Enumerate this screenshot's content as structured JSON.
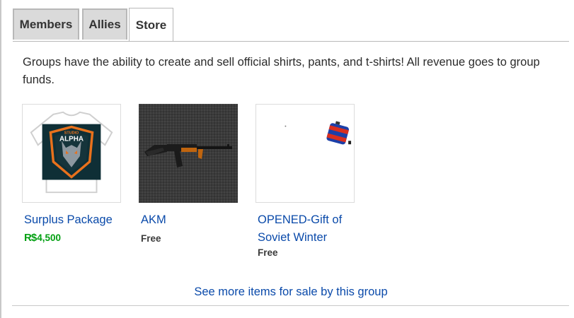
{
  "tabs": [
    {
      "label": "Members",
      "active": false
    },
    {
      "label": "Allies",
      "active": false
    },
    {
      "label": "Store",
      "active": true
    }
  ],
  "store": {
    "description": "Groups have the ability to create and sell official shirts, pants, and t-shirts! All revenue goes to group funds.",
    "items": [
      {
        "name": "Surplus Package",
        "price": "4,500",
        "currency_icon": "robux-icon",
        "thumbnail_icon": "alpha-tshirt-icon",
        "logo_text_top": "STUDIO",
        "logo_text": "ALPHA"
      },
      {
        "name": "AKM",
        "price": "Free",
        "thumbnail_icon": "akm-rifle-icon"
      },
      {
        "name": "OPENED-Gift of Soviet Winter",
        "price": "Free",
        "thumbnail_icon": "gift-box-icon"
      }
    ],
    "see_more": "See more items for sale by this group"
  },
  "colors": {
    "link": "#0a4aaa",
    "robux_price": "#02a012",
    "tab_inactive_bg": "#dadada",
    "tab_active_bg": "#ffffff"
  }
}
